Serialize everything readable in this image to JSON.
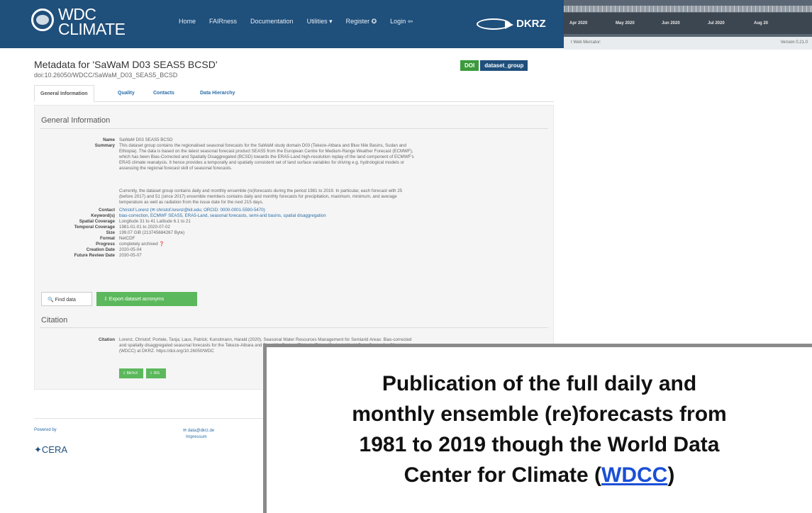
{
  "header": {
    "brand_line1": "WDC",
    "brand_line2": "CLIMATE",
    "nav": [
      "Home",
      "FAIRness",
      "Documentation",
      "Utilities ▾",
      "Register ✪",
      "Login ⇦"
    ],
    "partner_logo": "DKRZ"
  },
  "timeline": {
    "months": [
      "Apr 2020",
      "May 2020",
      "Jun 2020",
      "Jul 2020",
      "Aug 20"
    ],
    "projection": "t Web Mercator:",
    "version": "Version 0.21.0"
  },
  "page": {
    "title": "Metadata for 'SaWaM D03 SEAS5 BCSD'",
    "doi": "doi:10.26050/WDCC/SaWaM_D03_SEAS5_BCSD",
    "badge_doi": "DOI",
    "badge_type": "dataset_group"
  },
  "tabs": [
    "General Information",
    "Quality",
    "Contacts",
    "Data Hierarchy"
  ],
  "general": {
    "heading": "General Information",
    "name_label": "Name",
    "name": "SaWaM D03 SEAS5 BCSD",
    "summary_label": "Summary",
    "summary_lines": [
      "This dataset group contains the regionalised seasonal forecasts for the SaWaM study domain D03 (Tekeze-Atbara and Blue Nile Basins, Sudan and",
      "Ethiopia). The data is based on the latest seasonal forecast product SEAS5 from the European Centre for Medium-Range Weather Forecast (ECMWF),",
      "which has been Bias-Corrected and Spatially Disaggregated (BCSD) towards the ERA5-Land high-resolution replay of the land component of ECMWF's",
      "ERA5 climate reanalysis. It hence provides a temporally and spatially consistent set of land surface variables for driving e.g. hydrological models or",
      "assessing the regional forecast skill of seasonal forecasts.",
      "",
      "Currently, the dataset group contains daily and monthly ensemble (re)forecasts during the period 1981 to 2019. In particular, each forecast with 25",
      "(before 2017) and 51 (since 2017) ensemble members contains daily and monthly forecasts for precipitation, maximum, minimum, and average",
      "temperature as well as radiation from the issue date for the next 215 days."
    ],
    "fields": [
      {
        "label": "Contact",
        "value": "Christof Lorenz (✉ christof.lorenz@kit.edu; ORCID: 0000-0001-5590-5470)"
      },
      {
        "label": "Keyword(s)",
        "value": "bias-correction, ECMWF SEAS5, ERA5-Land, seasonal forecasts, semi-arid basins, spatial disaggregation"
      },
      {
        "label": "Spatial Coverage",
        "value": "Longitude 31 to 41 Latitude 6.1 to 21"
      },
      {
        "label": "Temporal Coverage",
        "value": "1981-01-01 to 2020-07-02"
      },
      {
        "label": "Size",
        "value": "199.07 GiB (213745684267 Byte)"
      },
      {
        "label": "Format",
        "value": "NetCDF"
      },
      {
        "label": "Progress",
        "value": "completely archived ❓"
      },
      {
        "label": "Creation Date",
        "value": "2020-05-04"
      },
      {
        "label": "Future Review Date",
        "value": "2030-05-07"
      }
    ],
    "find_button": "🔍 Find data",
    "export_button": "⇩ Export dataset acronyms"
  },
  "citation": {
    "heading": "Citation",
    "label": "Citation",
    "lines": [
      "Lorenz, Christof; Portele, Tanja; Laux, Patrick; Kunstmann, Harald (2020). Seasonal Water Resources Management for Semiarid Areas: Bias-corrected",
      "and spatially disaggregated seasonal forecasts for the Tekeze-Atbara and Blue Nile Basins (Ethiopia/Eritrea/Sudan). World Data Center for Climate",
      "(WDCC) at DKRZ. https://doi.org/10.26050/WDC"
    ],
    "btn1": "⇩ BibTeX",
    "btn2": "⇩ RIS"
  },
  "footer": {
    "powered": "Powered by",
    "cera": "✦CERA",
    "mail": "✉ data@dkrz.de",
    "impressum": "Impressum"
  },
  "caption": {
    "line1": "Publication of the full daily and",
    "line2": "monthly ensemble (re)forecasts from",
    "line3": "1981 to 2019 though the World Data",
    "line4_pre": "Center for Climate (",
    "line4_link": "WDCC",
    "line4_post": ")"
  }
}
